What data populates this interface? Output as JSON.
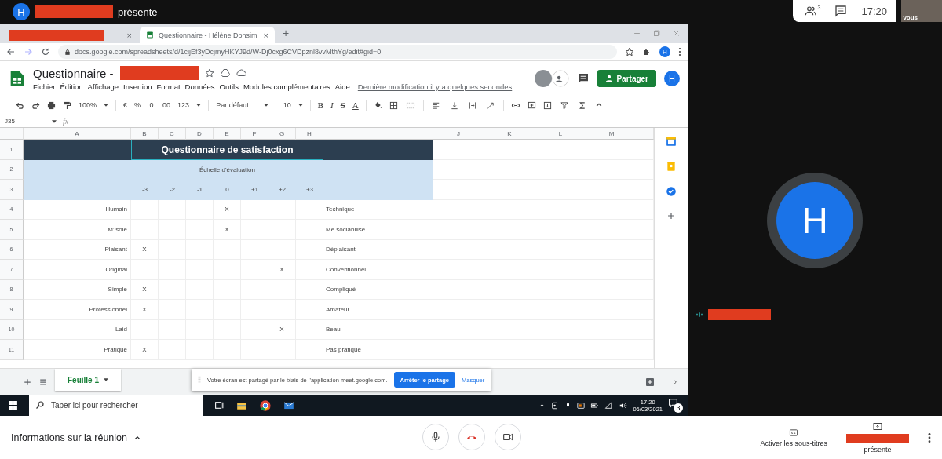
{
  "meet_top": {
    "avatar_letter": "H",
    "presenter_suffix": "présente",
    "participants_count": "3",
    "clock": "17:20",
    "self_label": "Vous"
  },
  "browser": {
    "tabs": [
      {
        "kind": "redacted",
        "selected": false,
        "close": "×"
      },
      {
        "kind": "titled",
        "title": "Questionnaire - Hélène Donsim",
        "selected": true,
        "close": "×"
      }
    ],
    "new_tab": "+",
    "address": "docs.google.com/spreadsheets/d/1cijEf3yDcjmyHKYJ9d/W-Dj0cxg6CVDpznl8vvMthYg/edit#gid=0",
    "profile": "H"
  },
  "sheets": {
    "doc_title": "Questionnaire -",
    "menus": [
      "Fichier",
      "Édition",
      "Affichage",
      "Insertion",
      "Format",
      "Données",
      "Outils",
      "Modules complémentaires",
      "Aide"
    ],
    "last_edit": "Dernière modification il y a quelques secondes",
    "share": "Partager",
    "account": "H",
    "toolbar": {
      "zoom": "100%",
      "currency": "€",
      "percent": "%",
      "decimal_less": ".0",
      "decimal_more": ".00",
      "number_format": "123",
      "font": "Par défaut ...",
      "font_size": "10",
      "text_styles": [
        "B",
        "I",
        "S",
        "A"
      ]
    },
    "cell_ref": "J35",
    "fx": "fx",
    "columns": [
      "A",
      "B",
      "C",
      "D",
      "E",
      "F",
      "G",
      "H",
      "I",
      "J",
      "K",
      "L",
      "M"
    ],
    "row_numbers": [
      "1",
      "2",
      "3",
      "4",
      "5",
      "6",
      "7",
      "8",
      "9",
      "10",
      "11"
    ],
    "title": "Questionnaire de satisfaction",
    "scale_label": "Échelle d'évaluation",
    "scale": [
      "-3",
      "-2",
      "-1",
      "0",
      "+1",
      "+2",
      "+3"
    ],
    "rows": [
      {
        "left": "Humain",
        "mark": "X",
        "checked": [
          false,
          false,
          false,
          true,
          false,
          false,
          false
        ],
        "right": "Technique"
      },
      {
        "left": "M'isole",
        "mark": "X",
        "checked": [
          false,
          false,
          false,
          true,
          false,
          false,
          false
        ],
        "right": "Me sociabilise"
      },
      {
        "left": "Plaisant",
        "mark": "X",
        "checked": [
          true,
          false,
          false,
          false,
          false,
          false,
          false
        ],
        "right": "Déplaisant"
      },
      {
        "left": "Original",
        "mark": "X",
        "checked": [
          false,
          false,
          false,
          false,
          false,
          true,
          false
        ],
        "right": "Conventionnel"
      },
      {
        "left": "Simple",
        "mark": "X",
        "checked": [
          true,
          false,
          false,
          false,
          false,
          false,
          false
        ],
        "right": "Compliqué"
      },
      {
        "left": "Professionnel",
        "mark": "X",
        "checked": [
          true,
          false,
          false,
          false,
          false,
          false,
          false
        ],
        "right": "Amateur"
      },
      {
        "left": "Laid",
        "mark": "X",
        "checked": [
          false,
          false,
          false,
          false,
          false,
          true,
          false
        ],
        "right": "Beau"
      },
      {
        "left": "Pratique",
        "mark": "X",
        "checked": [
          true,
          false,
          false,
          false,
          false,
          false,
          false
        ],
        "right": "Pas pratique"
      }
    ],
    "sheet_tabs": [
      {
        "label": "Feuille 1",
        "selected": true
      }
    ],
    "share_banner": {
      "message": "Votre écran est partagé par le biais de l'application meet.google.com.",
      "stop": "Arrêter le partage",
      "hide": "Masquer"
    }
  },
  "taskbar": {
    "search_placeholder": "Taper ici pour rechercher",
    "time": "17:20",
    "date": "06/03/2021",
    "notifications": "3"
  },
  "participant": {
    "avatar_letter": "H"
  },
  "meet_bottom": {
    "info": "Informations sur la réunion",
    "captions": "Activer les sous-titres",
    "present_label": "présente"
  }
}
